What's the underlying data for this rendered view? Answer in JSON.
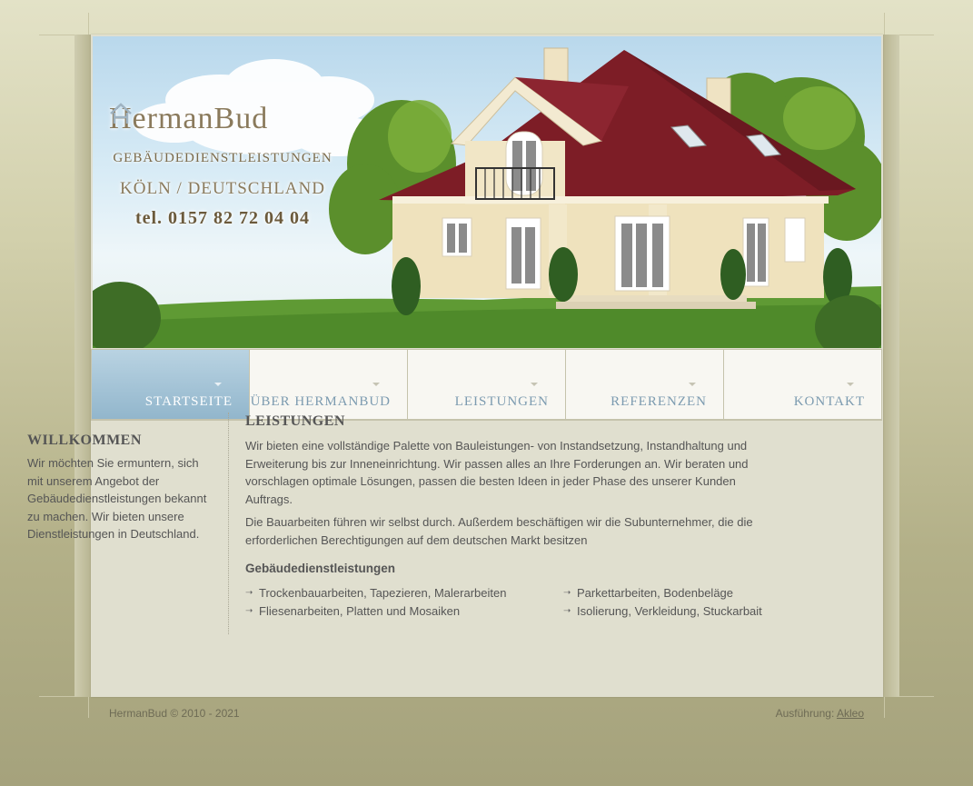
{
  "brand": {
    "name_part1": "Herman",
    "name_part2": "Bud",
    "subtitle": "GEBÄUDEDIENSTLEISTUNGEN",
    "city": "KÖLN / DEUTSCHLAND",
    "phone": "tel. 0157 82 72 04 04"
  },
  "nav": {
    "items": [
      {
        "label": "STARTSEITE",
        "active": true
      },
      {
        "label": "ÜBER HERMANBUD",
        "active": false
      },
      {
        "label": "LEISTUNGEN",
        "active": false
      },
      {
        "label": "REFERENZEN",
        "active": false
      },
      {
        "label": "KONTAKT",
        "active": false
      }
    ]
  },
  "welcome": {
    "title": "WILLKOMMEN",
    "text": "Wir möchten Sie ermuntern, sich mit unserem Angebot der Gebäudedienstleistungen bekannt zu machen. Wir bieten unsere Dienstleistungen in Deutschland."
  },
  "services": {
    "title": "LEISTUNGEN",
    "para1": "Wir bieten eine vollständige Palette von Bauleistungen- von Instandsetzung, Instandhaltung und Erweiterung bis zur Inneneinrichtung. Wir passen alles an Ihre Forderungen an. Wir beraten und vorschlagen optimale Lösungen, passen die besten Ideen in jeder Phase des unserer Kunden Auftrags.",
    "para2": "Die Bauarbeiten führen wir selbst durch. Außerdem beschäftigen wir die Subunternehmer, die die erforderlichen Berechtigungen auf dem deutschen Markt besitzen",
    "subtitle": "Gebäudedienstleistungen",
    "list_left": [
      "Trockenbauarbeiten, Tapezieren, Malerarbeiten",
      "Fliesenarbeiten, Platten und Mosaiken"
    ],
    "list_right": [
      "Parkettarbeiten, Bodenbeläge",
      "Isolierung, Verkleidung, Stuckarbait"
    ]
  },
  "footer": {
    "copyright": "HermanBud © 2010 - 2021",
    "credit_label": "Ausführung: ",
    "credit_link": "Akleo"
  },
  "colors": {
    "accent_blue": "#92b6cc",
    "roof": "#7d1d26",
    "wall": "#efe2bd"
  }
}
